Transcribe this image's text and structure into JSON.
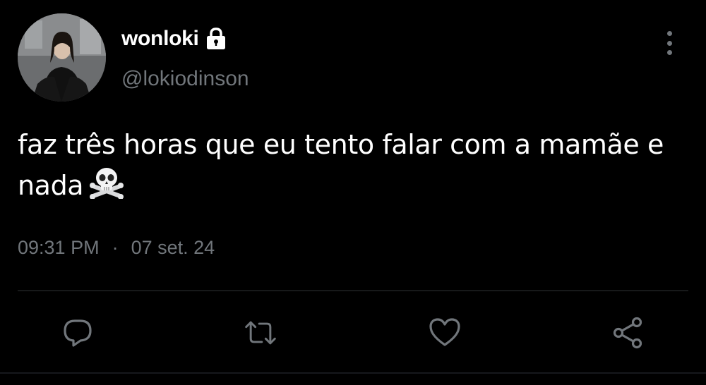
{
  "author": {
    "display_name": "wonloki",
    "handle": "@lokiodinson",
    "protected_icon": "lock-icon",
    "avatar": "profile-photo"
  },
  "tweet": {
    "text": "faz três horas que eu tento falar com a mamãe e nada",
    "emoji": "skull-and-crossbones-icon"
  },
  "meta": {
    "time": "09:31 PM",
    "separator": "·",
    "date": "07 set. 24"
  },
  "actions": [
    "reply-icon",
    "retweet-icon",
    "like-icon",
    "share-icon"
  ],
  "colors": {
    "background": "#000000",
    "primary_text": "#ffffff",
    "secondary_text": "#71767b",
    "divider": "#2f3336"
  }
}
